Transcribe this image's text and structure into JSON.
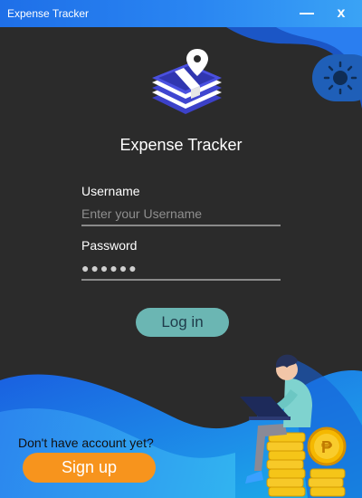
{
  "window": {
    "title": "Expense Tracker",
    "minimize_label": "",
    "close_label": "x"
  },
  "theme_toggle": {
    "icon": "sun-icon"
  },
  "logo": {
    "icon": "money-location-icon"
  },
  "app_title": "Expense Tracker",
  "form": {
    "username_label": "Username",
    "username_placeholder": "Enter your Username",
    "username_value": "",
    "password_label": "Password",
    "password_value": "●●●●●●"
  },
  "login_button": "Log in",
  "signup_prompt": "Don't have account yet?",
  "signup_button": "Sign up",
  "colors": {
    "background": "#2b2b2b",
    "titlebar": "#2a86f2",
    "login_button": "#6bb6b3",
    "signup_button": "#f7941d",
    "wave_blue": "#1f6fe0"
  },
  "illustration": {
    "icon": "person-on-coins-illustration"
  }
}
